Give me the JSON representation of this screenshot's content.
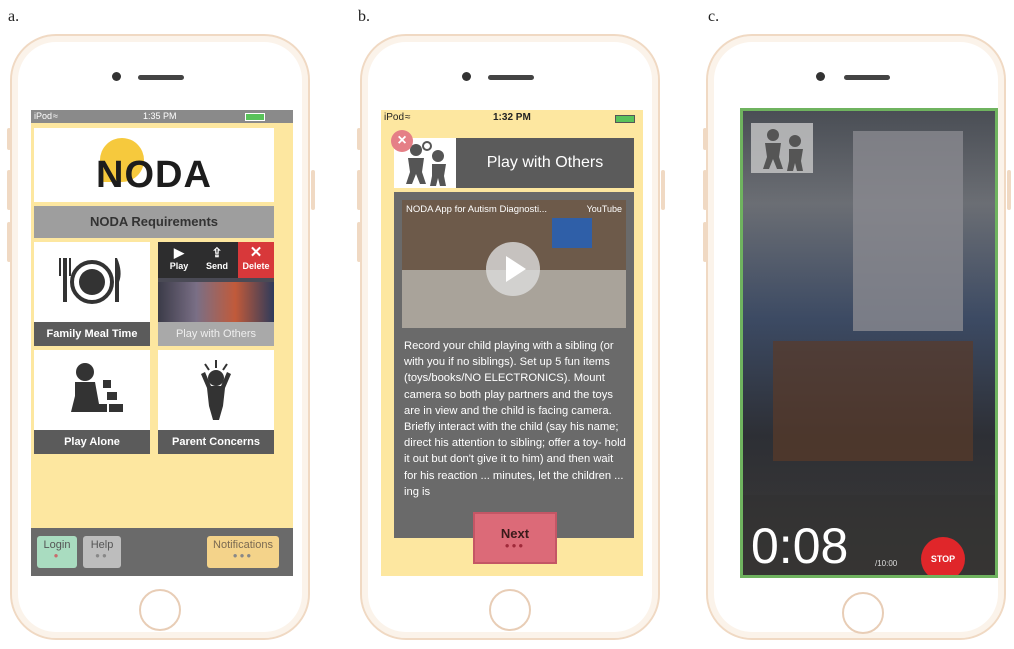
{
  "labels": {
    "a": "a.",
    "b": "b.",
    "c": "c."
  },
  "screen_a": {
    "status": {
      "carrier": "iPod",
      "time": "1:35 PM"
    },
    "logo": "NODA",
    "requirements_label": "NODA Requirements",
    "tiles": [
      {
        "label": "Family Meal Time",
        "icon": "plate-icon"
      },
      {
        "label": "Play with Others",
        "icon": "video-thumbnail"
      },
      {
        "label": "Play Alone",
        "icon": "child-blocks-icon"
      },
      {
        "label": "Parent Concerns",
        "icon": "worried-child-icon"
      }
    ],
    "overlay_actions": {
      "play": "Play",
      "send": "Send",
      "delete": "Delete"
    },
    "bottom": {
      "login": "Login",
      "help": "Help",
      "notifications": "Notifications"
    }
  },
  "screen_b": {
    "status": {
      "carrier": "iPod",
      "time": "1:32 PM"
    },
    "title": "Play with Others",
    "video_title": "NODA App for Autism Diagnosti...",
    "video_source": "YouTube",
    "description": "Record your child playing with a sibling (or with you if no siblings). Set up 5 fun items (toys/books/NO ELECTRONICS). Mount camera so both play partners and the toys are in view and the child is facing camera. Briefly interact with the child (say his name; direct his attention to sibling; offer a toy- hold it out but don't give it to him) and then wait for his reaction ... minutes, let the children ... ing is",
    "next_label": "Next"
  },
  "screen_c": {
    "timer": "0:08",
    "timer_total": "/10:00",
    "stop_label": "STOP"
  },
  "colors": {
    "phone_yellow": "#fde7a0",
    "dark_gray": "#5b5b5b",
    "accent_red": "#dc6a78",
    "record_green": "#6fb35f"
  }
}
